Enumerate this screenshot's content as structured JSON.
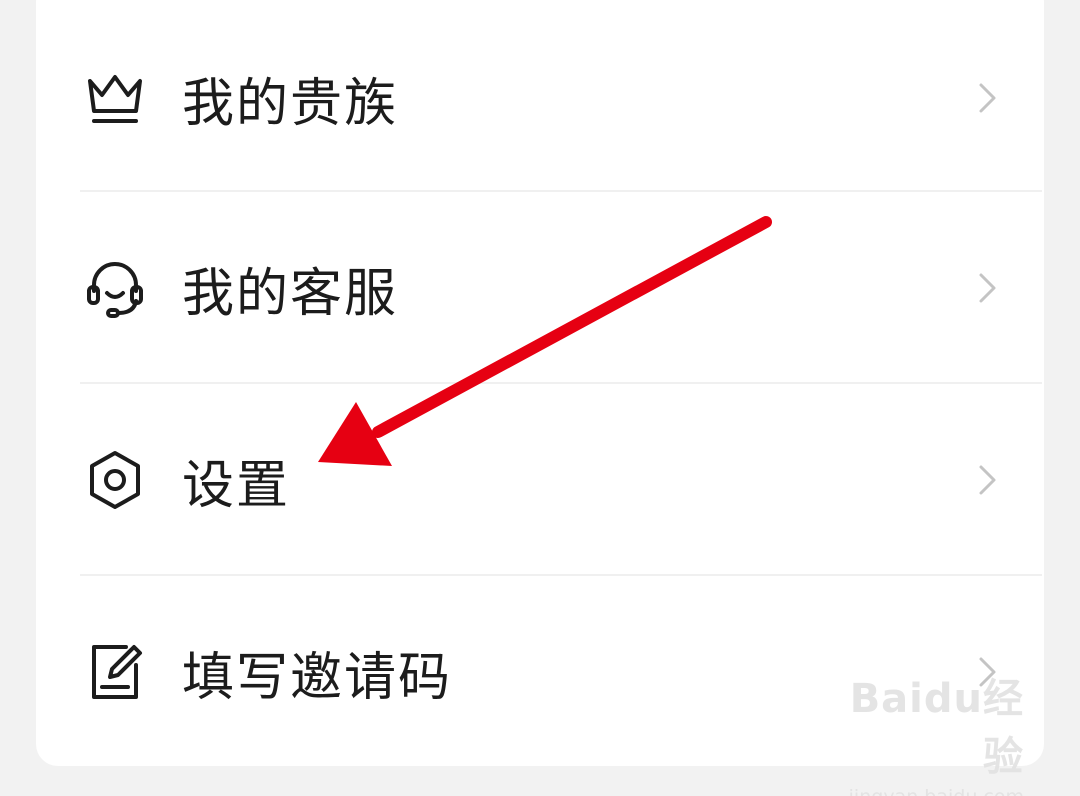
{
  "menu": {
    "items": [
      {
        "label": "我的贵族",
        "icon": "crown-icon"
      },
      {
        "label": "我的客服",
        "icon": "headset-icon"
      },
      {
        "label": "设置",
        "icon": "settings-hexagon-icon"
      },
      {
        "label": "填写邀请码",
        "icon": "edit-note-icon"
      }
    ]
  },
  "annotation": {
    "arrow_color": "#e60012",
    "arrow_target": "设置"
  },
  "watermark": {
    "logo": "Baidu经验",
    "url": "jingyan.baidu.com"
  },
  "colors": {
    "background": "#f2f2f2",
    "card": "#ffffff",
    "text": "#1c1c1c",
    "chevron": "#c4c4c4"
  }
}
